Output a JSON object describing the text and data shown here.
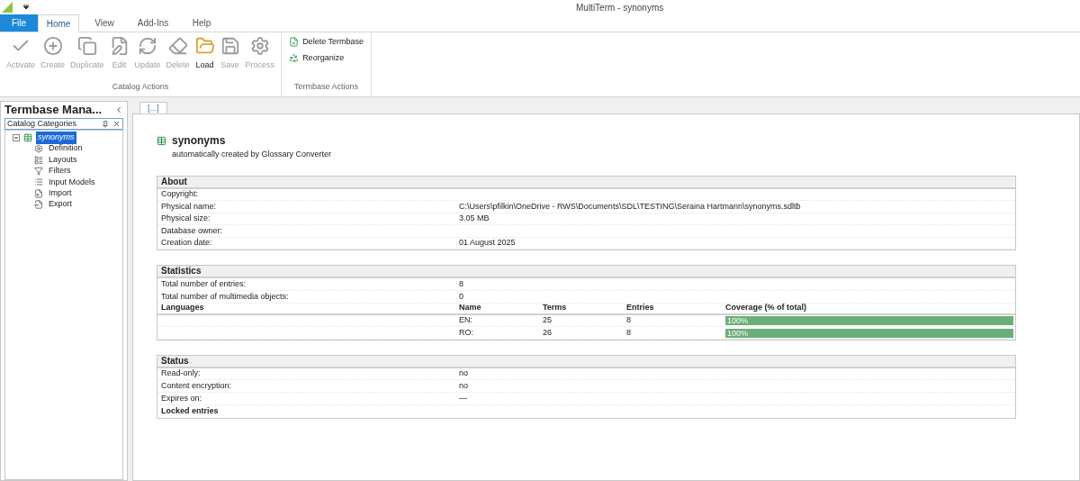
{
  "window": {
    "title": "MultiTerm - synonyms"
  },
  "ribbon_tabs": [
    {
      "label": "File",
      "kind": "file",
      "selected": false
    },
    {
      "label": "Home",
      "kind": "tab",
      "selected": true
    },
    {
      "label": "View",
      "kind": "tab",
      "selected": false
    },
    {
      "label": "Add-Ins",
      "kind": "tab",
      "selected": false
    },
    {
      "label": "Help",
      "kind": "tab",
      "selected": false
    }
  ],
  "ribbon_groups": [
    {
      "title": "Catalog Actions",
      "kind": "large",
      "buttons": [
        {
          "label": "Activate",
          "disabled": true
        },
        {
          "label": "Create",
          "disabled": true
        },
        {
          "label": "Duplicate",
          "disabled": true
        },
        {
          "label": "Edit",
          "disabled": true
        },
        {
          "label": "Update",
          "disabled": true
        },
        {
          "label": "Delete",
          "disabled": true
        },
        {
          "label": "Load",
          "disabled": false
        },
        {
          "label": "Save",
          "disabled": true
        },
        {
          "label": "Process",
          "disabled": true
        }
      ]
    },
    {
      "title": "Termbase Actions",
      "kind": "small",
      "buttons": [
        {
          "label": "Delete Termbase",
          "disabled": false
        },
        {
          "label": "Reorganize",
          "disabled": false
        }
      ]
    }
  ],
  "side_panel": {
    "title": "Termbase Mana...",
    "category_box": "Catalog Categories",
    "tree": [
      {
        "label": "synonyms",
        "selected": true,
        "expanded": true,
        "children": [
          {
            "label": "Definition",
            "selected": false
          },
          {
            "label": "Layouts",
            "selected": false
          },
          {
            "label": "Filters",
            "selected": false
          },
          {
            "label": "Input Models",
            "selected": false
          },
          {
            "label": "Import",
            "selected": false
          },
          {
            "label": "Export",
            "selected": false
          }
        ]
      }
    ]
  },
  "document_tab": {
    "label": "[...]"
  },
  "termbase": {
    "name": "synonyms",
    "description": "automatically created by Glossary Converter"
  },
  "about": {
    "title": "About",
    "rows": [
      {
        "label": "Copyright:"
      },
      {
        "label": "Physical name:",
        "value": "C:\\Users\\pfilkin\\OneDrive - RWS\\Documents\\SDL\\TESTING\\Seraina Hartmann\\synonyms.sdltb"
      },
      {
        "label": "Physical size:",
        "value": "3.05 MB"
      },
      {
        "label": "Database owner:"
      },
      {
        "label": "Creation date:",
        "value": "01 August 2025"
      }
    ]
  },
  "statistics": {
    "title": "Statistics",
    "rows": [
      {
        "label": "Total number of entries:",
        "value": "8"
      },
      {
        "label": "Total number of multimedia objects:",
        "value": "0"
      }
    ],
    "languages_title": "Languages",
    "columns": [
      "Name",
      "Terms",
      "Entries",
      "Coverage (% of total)"
    ],
    "languages": [
      {
        "name": "EN:",
        "terms": "25",
        "entries": "8",
        "coverage": "100%",
        "level": 1
      },
      {
        "name": "RO:",
        "terms": "26",
        "entries": "8",
        "coverage": "100%",
        "level": 1
      }
    ]
  },
  "status": {
    "title": "Status",
    "rows": [
      {
        "label": "Read-only:",
        "value": "no"
      },
      {
        "label": "Content encryption:",
        "value": "no"
      },
      {
        "label": "Expires on:",
        "value": "—"
      }
    ],
    "footer": "Locked entries"
  }
}
